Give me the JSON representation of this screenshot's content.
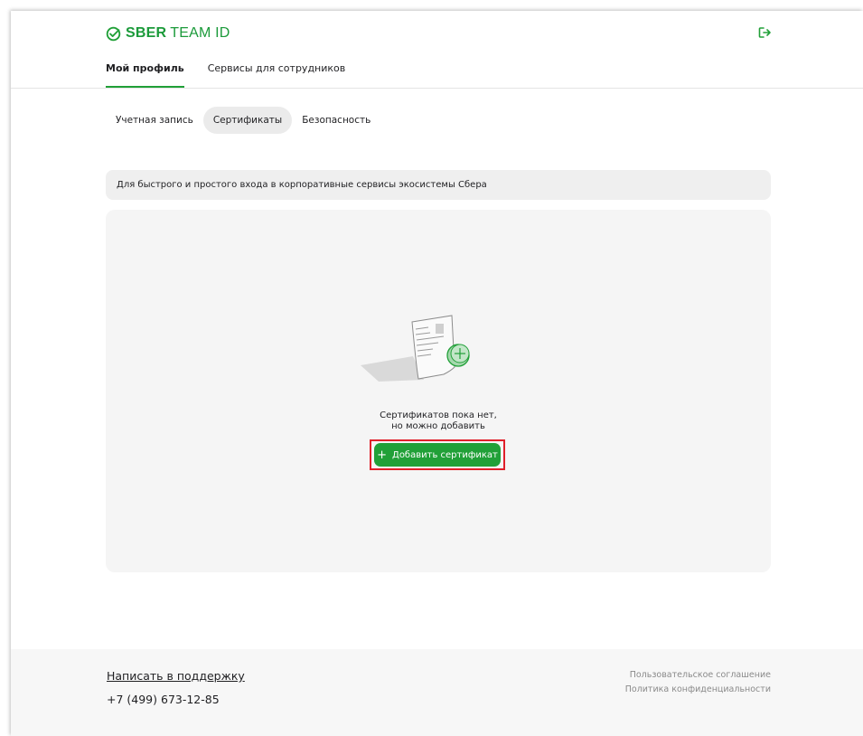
{
  "app": {
    "logo_bold": "SBER",
    "logo_regular": "TEAM ID",
    "colors": {
      "brand_green": "#21a038",
      "highlight_red": "#e0202a"
    }
  },
  "header": {
    "logout_icon": "logout-icon",
    "tabs": [
      {
        "label": "Мой профиль",
        "active": true
      },
      {
        "label": "Сервисы для сотрудников",
        "active": false
      }
    ]
  },
  "subtabs": [
    {
      "label": "Учетная запись",
      "active": false
    },
    {
      "label": "Сертификаты",
      "active": true
    },
    {
      "label": "Безопасность",
      "active": false
    }
  ],
  "banner": {
    "text": "Для быстрого и простого входа в корпоративные сервисы экосистемы Сбера"
  },
  "empty_state": {
    "icon": "document-add-icon",
    "line1": "Сертификатов пока нет,",
    "line2": "но можно добавить",
    "button_plus": "+",
    "button_label": "Добавить сертификат"
  },
  "footer": {
    "support": "Написать в поддержку",
    "phone": "+7 (499) 673-12-85",
    "agreement": "Пользовательское соглашение",
    "privacy": "Политика конфиденциальности"
  }
}
